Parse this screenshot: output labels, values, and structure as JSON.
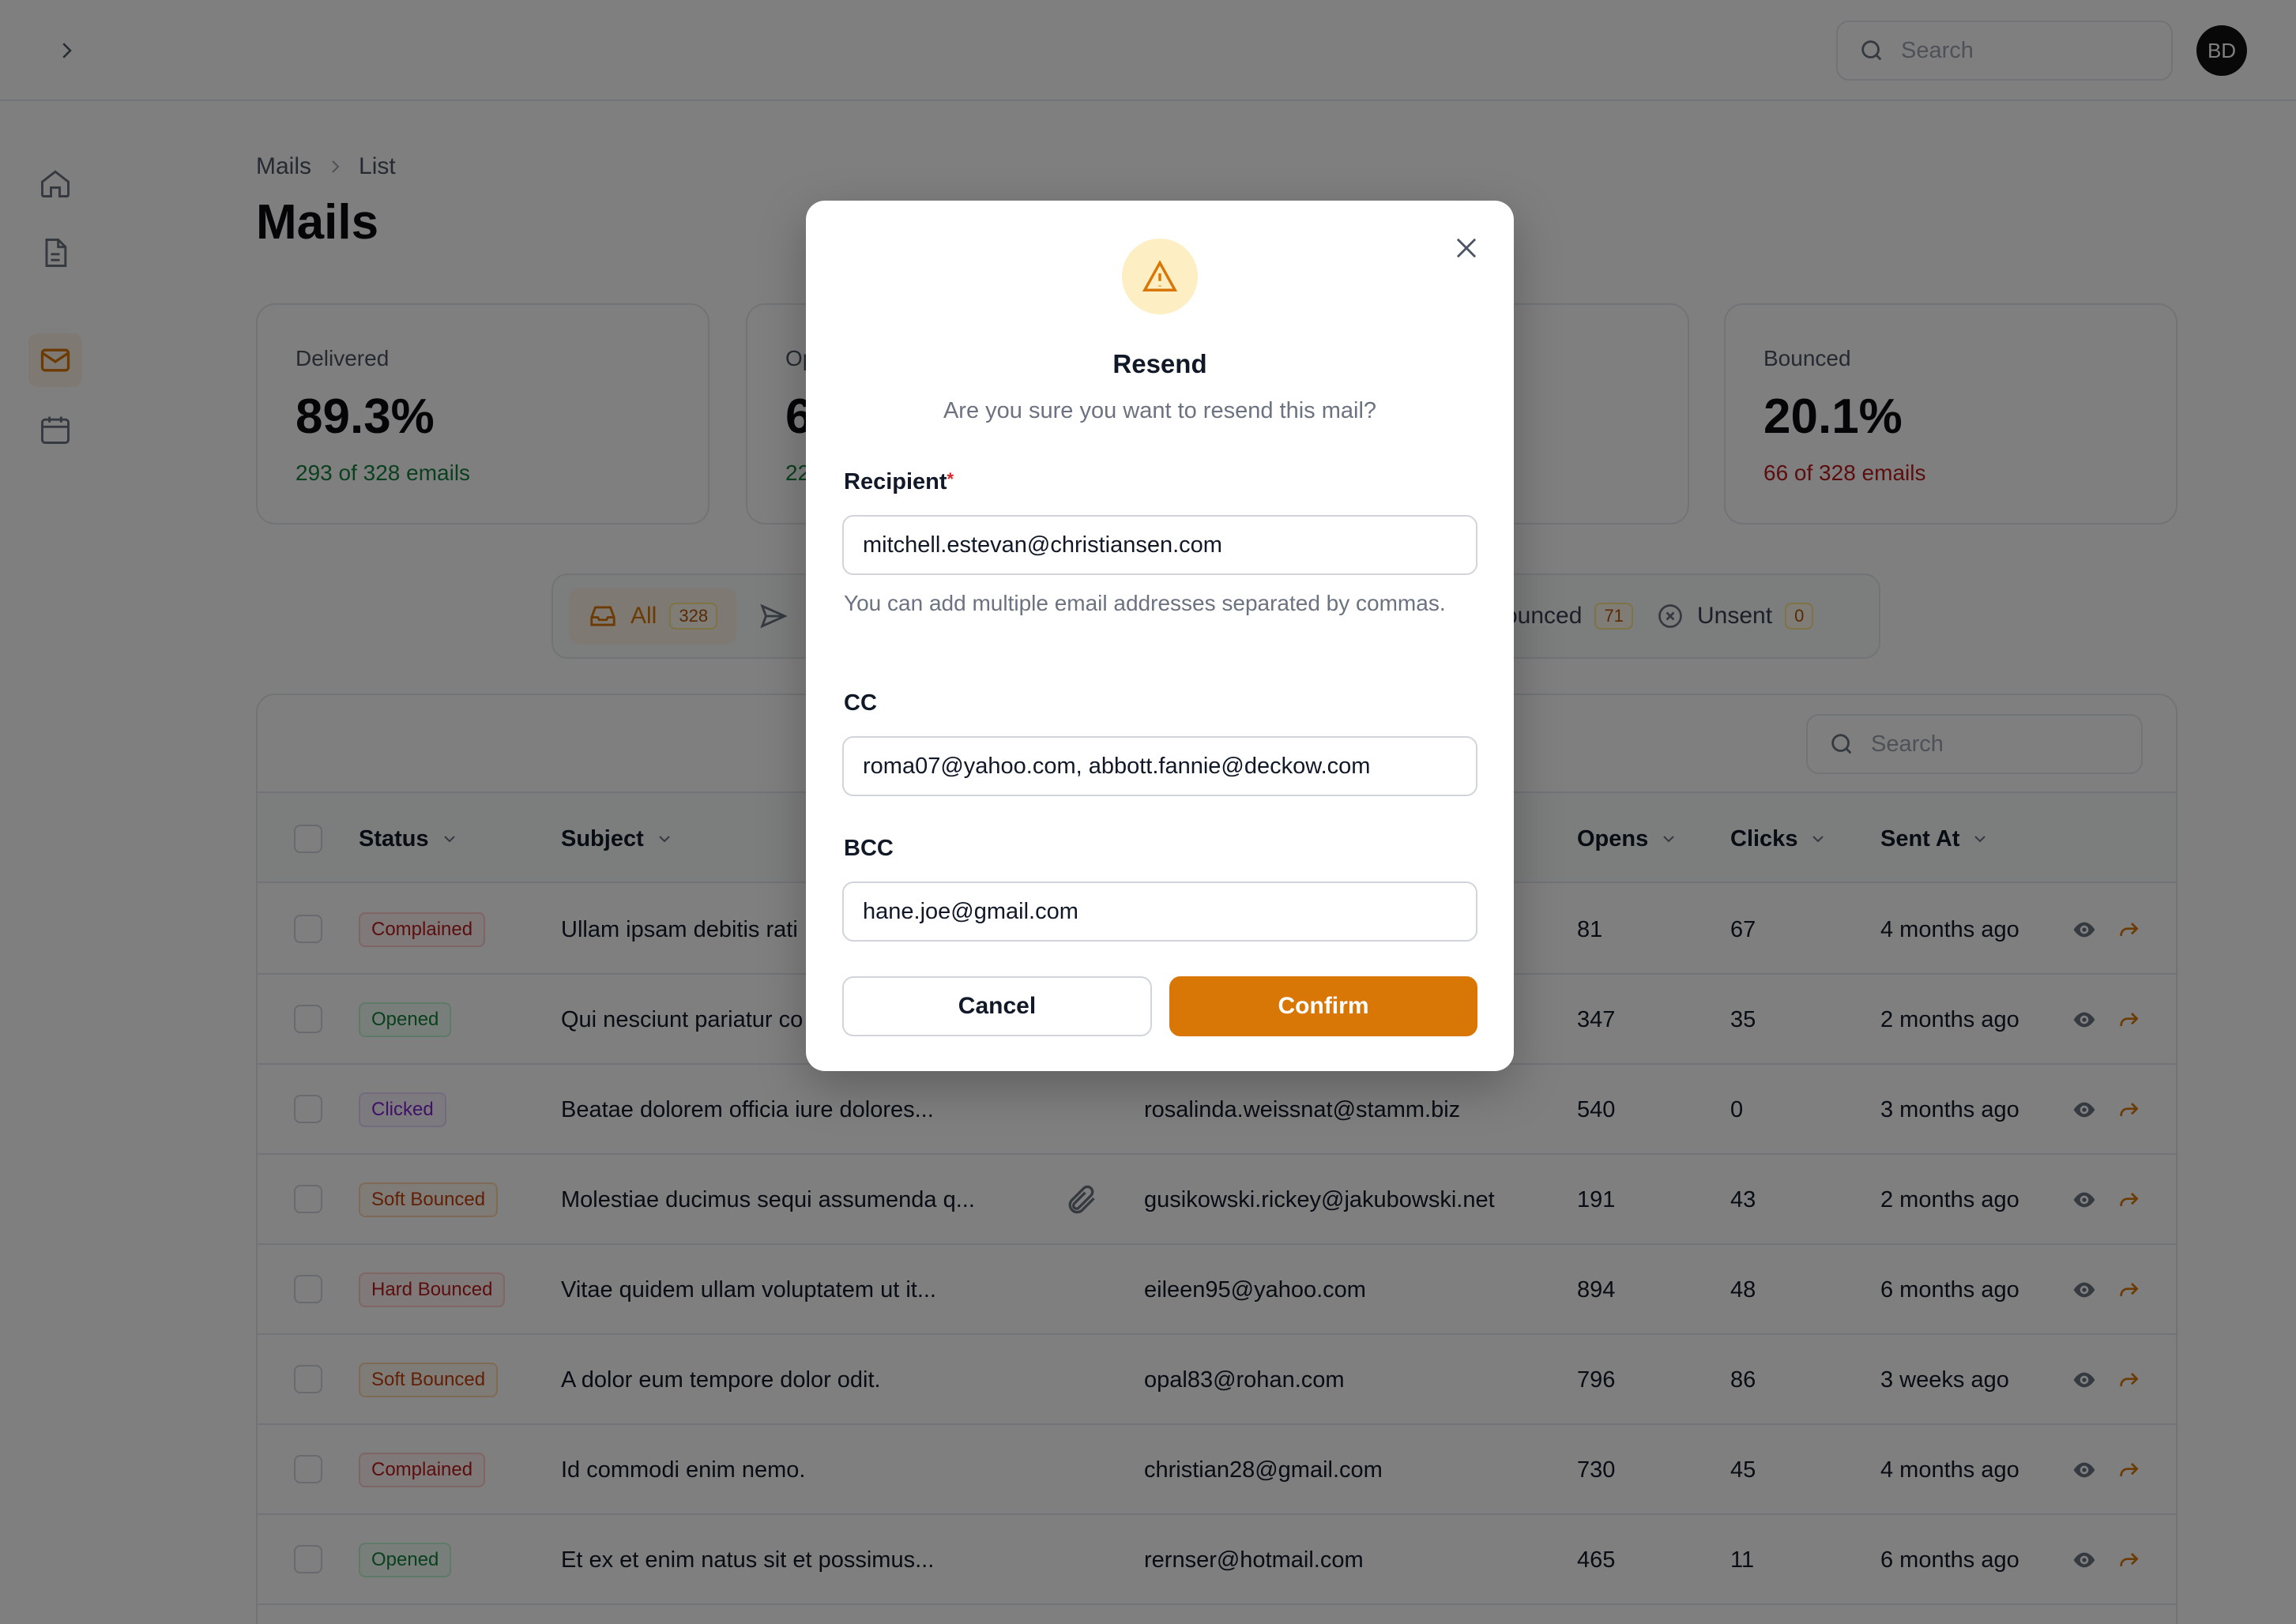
{
  "topbar": {
    "search_placeholder": "Search",
    "avatar_initials": "BD"
  },
  "breadcrumb": {
    "items": [
      "Mails",
      "List"
    ]
  },
  "page_title": "Mails",
  "stats": [
    {
      "label": "Delivered",
      "value": "89.3%",
      "sub": "293 of 328 emails"
    },
    {
      "label": "Op",
      "value": "6",
      "sub": "22"
    },
    {
      "label": "Bounced",
      "value": "20.1%",
      "sub": "66 of 328 emails"
    }
  ],
  "tabs": [
    {
      "label": "All",
      "count": "328"
    },
    {
      "label": "ounced",
      "count": "71"
    },
    {
      "label": "Unsent",
      "count": "0"
    }
  ],
  "table": {
    "search_placeholder": "Search",
    "columns": [
      "Status",
      "Subject",
      "Opens",
      "Clicks",
      "Sent At"
    ],
    "rows": [
      {
        "status": "Complained",
        "subject": "Ullam ipsam debitis rati",
        "recipient": "",
        "opens": "81",
        "clicks": "67",
        "sent": "4 months ago"
      },
      {
        "status": "Opened",
        "subject": "Qui nesciunt pariatur co",
        "recipient": "",
        "opens": "347",
        "clicks": "35",
        "sent": "2 months ago"
      },
      {
        "status": "Clicked",
        "subject": "Beatae dolorem officia iure dolores...",
        "recipient": "rosalinda.weissnat@stamm.biz",
        "opens": "540",
        "clicks": "0",
        "sent": "3 months ago"
      },
      {
        "status": "Soft Bounced",
        "subject": "Molestiae ducimus sequi assumenda q...",
        "recipient": "gusikowski.rickey@jakubowski.net",
        "opens": "191",
        "clicks": "43",
        "sent": "2 months ago"
      },
      {
        "status": "Hard Bounced",
        "subject": "Vitae quidem ullam voluptatem ut it...",
        "recipient": "eileen95@yahoo.com",
        "opens": "894",
        "clicks": "48",
        "sent": "6 months ago"
      },
      {
        "status": "Soft Bounced",
        "subject": "A dolor eum tempore dolor odit.",
        "recipient": "opal83@rohan.com",
        "opens": "796",
        "clicks": "86",
        "sent": "3 weeks ago"
      },
      {
        "status": "Complained",
        "subject": "Id commodi enim nemo.",
        "recipient": "christian28@gmail.com",
        "opens": "730",
        "clicks": "45",
        "sent": "4 months ago"
      },
      {
        "status": "Opened",
        "subject": "Et ex et enim natus sit et possimus...",
        "recipient": "rernser@hotmail.com",
        "opens": "465",
        "clicks": "11",
        "sent": "6 months ago"
      }
    ]
  },
  "modal": {
    "title": "Resend",
    "description": "Are you sure you want to resend this mail?",
    "recipient_label": "Recipient",
    "recipient_required_mark": "*",
    "recipient_value": "mitchell.estevan@christiansen.com",
    "recipient_hint": "You can add multiple email addresses separated by commas.",
    "cc_label": "CC",
    "cc_value": "roma07@yahoo.com, abbott.fannie@deckow.com",
    "bcc_label": "BCC",
    "bcc_value": "hane.joe@gmail.com",
    "cancel_label": "Cancel",
    "confirm_label": "Confirm"
  },
  "colors": {
    "accent": "#d97706",
    "accent_soft": "#fdefc3",
    "success": "#15803d",
    "danger": "#b91c1c"
  }
}
